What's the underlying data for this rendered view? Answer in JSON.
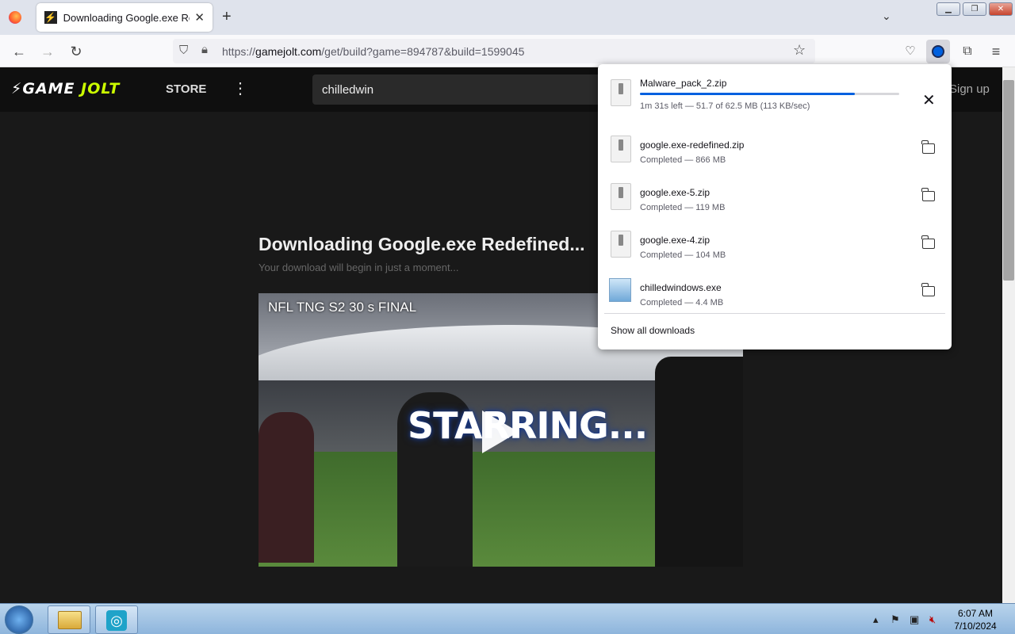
{
  "browser": {
    "tab_title": "Downloading Google.exe Redef",
    "new_tab_label": "+",
    "url_prefix": "https://",
    "url_domain": "gamejolt.com",
    "url_path": "/get/build?game=894787&build=1599045",
    "icons": [
      "firefox-icon",
      "back-icon",
      "forward-icon",
      "reload-icon",
      "shield-icon",
      "lock-icon",
      "star-icon",
      "pocket-icon",
      "downloads-icon",
      "extensions-icon",
      "menu-icon",
      "tab-list-icon"
    ]
  },
  "site": {
    "logo_game": "GAME",
    "logo_jolt": "JOLT",
    "store_label": "STORE",
    "search_value": "chilledwin",
    "signup_label": "Sign up",
    "download_title": "Downloading Google.exe Redefined...",
    "download_subtitle": "Your download will begin in just a moment...",
    "video_title": "NFL TNG S2 30 s FINAL",
    "video_overlay_text": "STARRING..."
  },
  "downloads": {
    "active": {
      "name": "Malware_pack_2.zip",
      "status": "1m 31s left — 51.7 of 62.5 MB (113 KB/sec)",
      "progress_fraction": 0.83
    },
    "completed": [
      {
        "name": "google.exe-redefined.zip",
        "status": "Completed — 866 MB"
      },
      {
        "name": "google.exe-5.zip",
        "status": "Completed — 119 MB"
      },
      {
        "name": "google.exe-4.zip",
        "status": "Completed — 104 MB"
      },
      {
        "name": "chilledwindows.exe",
        "status": "Completed — 4.4 MB"
      }
    ],
    "show_all_label": "Show all downloads"
  },
  "taskbar": {
    "time": "6:07 AM",
    "date": "7/10/2024"
  }
}
